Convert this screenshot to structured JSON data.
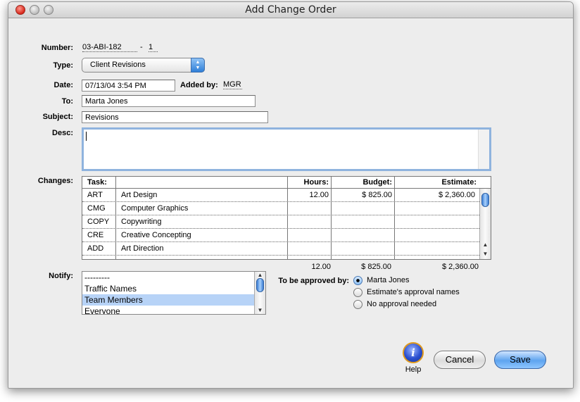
{
  "window": {
    "title": "Add Change Order"
  },
  "form": {
    "number_label": "Number:",
    "number_value": "03-ABI-182",
    "number_sep": "-",
    "number_suffix": "1",
    "type_label": "Type:",
    "type_value": "Client Revisions",
    "date_label": "Date:",
    "date_value": "07/13/04 3:54 PM",
    "added_by_label": "Added by:",
    "added_by_value": "MGR",
    "to_label": "To:",
    "to_value": "Marta Jones",
    "subject_label": "Subject:",
    "subject_value": "Revisions",
    "desc_label": "Desc:",
    "desc_value": ""
  },
  "changes": {
    "label": "Changes:",
    "headers": {
      "task": "Task:",
      "hours": "Hours:",
      "budget": "Budget:",
      "estimate": "Estimate:"
    },
    "rows": [
      {
        "code": "ART",
        "name": "Art Design",
        "hours": "12.00",
        "budget": "$ 825.00",
        "estimate": "$ 2,360.00"
      },
      {
        "code": "CMG",
        "name": "Computer Graphics",
        "hours": "",
        "budget": "",
        "estimate": ""
      },
      {
        "code": "COPY",
        "name": "Copywriting",
        "hours": "",
        "budget": "",
        "estimate": ""
      },
      {
        "code": "CRE",
        "name": "Creative Concepting",
        "hours": "",
        "budget": "",
        "estimate": ""
      },
      {
        "code": "ADD",
        "name": "Art Direction",
        "hours": "",
        "budget": "",
        "estimate": ""
      }
    ],
    "totals": {
      "hours": "12.00",
      "budget": "$ 825.00",
      "estimate": "$ 2,360.00"
    }
  },
  "notify": {
    "label": "Notify:",
    "items": [
      "---------",
      "Traffic Names",
      "Team Members",
      "Everyone"
    ],
    "selected_index": 2
  },
  "approval": {
    "label": "To be approved by:",
    "options": [
      "Marta Jones",
      "Estimate's approval names",
      "No approval needed"
    ],
    "selected_index": 0
  },
  "buttons": {
    "help": "Help",
    "cancel": "Cancel",
    "save": "Save"
  },
  "colors": {
    "selection": "#b7d3f7",
    "default_button": "#5ea4ef",
    "focus_ring": "#8fb3de"
  }
}
